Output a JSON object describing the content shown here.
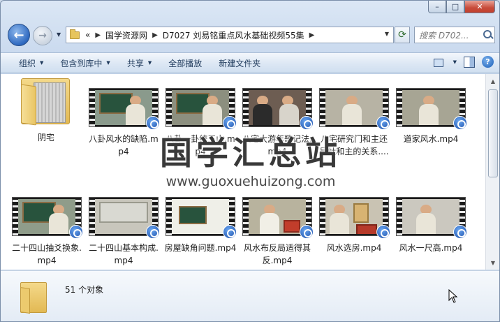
{
  "window": {
    "caption_buttons": {
      "minimize": "–",
      "maximize": "□",
      "close": "✕"
    }
  },
  "nav": {
    "back_glyph": "←",
    "forward_glyph": "→",
    "breadcrumb": [
      "«",
      "国学资源网",
      "D7027 刘易铭重点风水基础视频55集"
    ],
    "search_placeholder": "搜索 D702..."
  },
  "toolbar": {
    "organize": "组织",
    "include_in_library": "包含到库中",
    "share": "共享",
    "play_all": "全部播放",
    "new_folder": "新建文件夹"
  },
  "files": [
    {
      "name": "阴宅",
      "type": "folder"
    },
    {
      "name": "八卦风水的缺陷.mp4",
      "type": "video"
    },
    {
      "name": "八卦一卦统三山.mp4",
      "type": "video"
    },
    {
      "name": "八宅大游年歌记法.mp4",
      "type": "video"
    },
    {
      "name": "八宅研究门和主还是灶和主的关系....",
      "type": "video"
    },
    {
      "name": "道家风水.mp4",
      "type": "video"
    },
    {
      "name": "二十四山抽爻换象.mp4",
      "type": "video"
    },
    {
      "name": "二十四山基本构成.mp4",
      "type": "video"
    },
    {
      "name": "房屋缺角问题.mp4",
      "type": "video"
    },
    {
      "name": "风水布反局适得其反.mp4",
      "type": "video"
    },
    {
      "name": "风水选房.mp4",
      "type": "video"
    },
    {
      "name": "风水一尺高.mp4",
      "type": "video"
    }
  ],
  "watermark": {
    "text": "国学汇总站",
    "url": "www.guoxuehuizong.com"
  },
  "details": {
    "count_text": "51 个对象"
  },
  "colors": {
    "toolbar_text": "#1e395b",
    "window_frame": "#c9d9ee"
  }
}
